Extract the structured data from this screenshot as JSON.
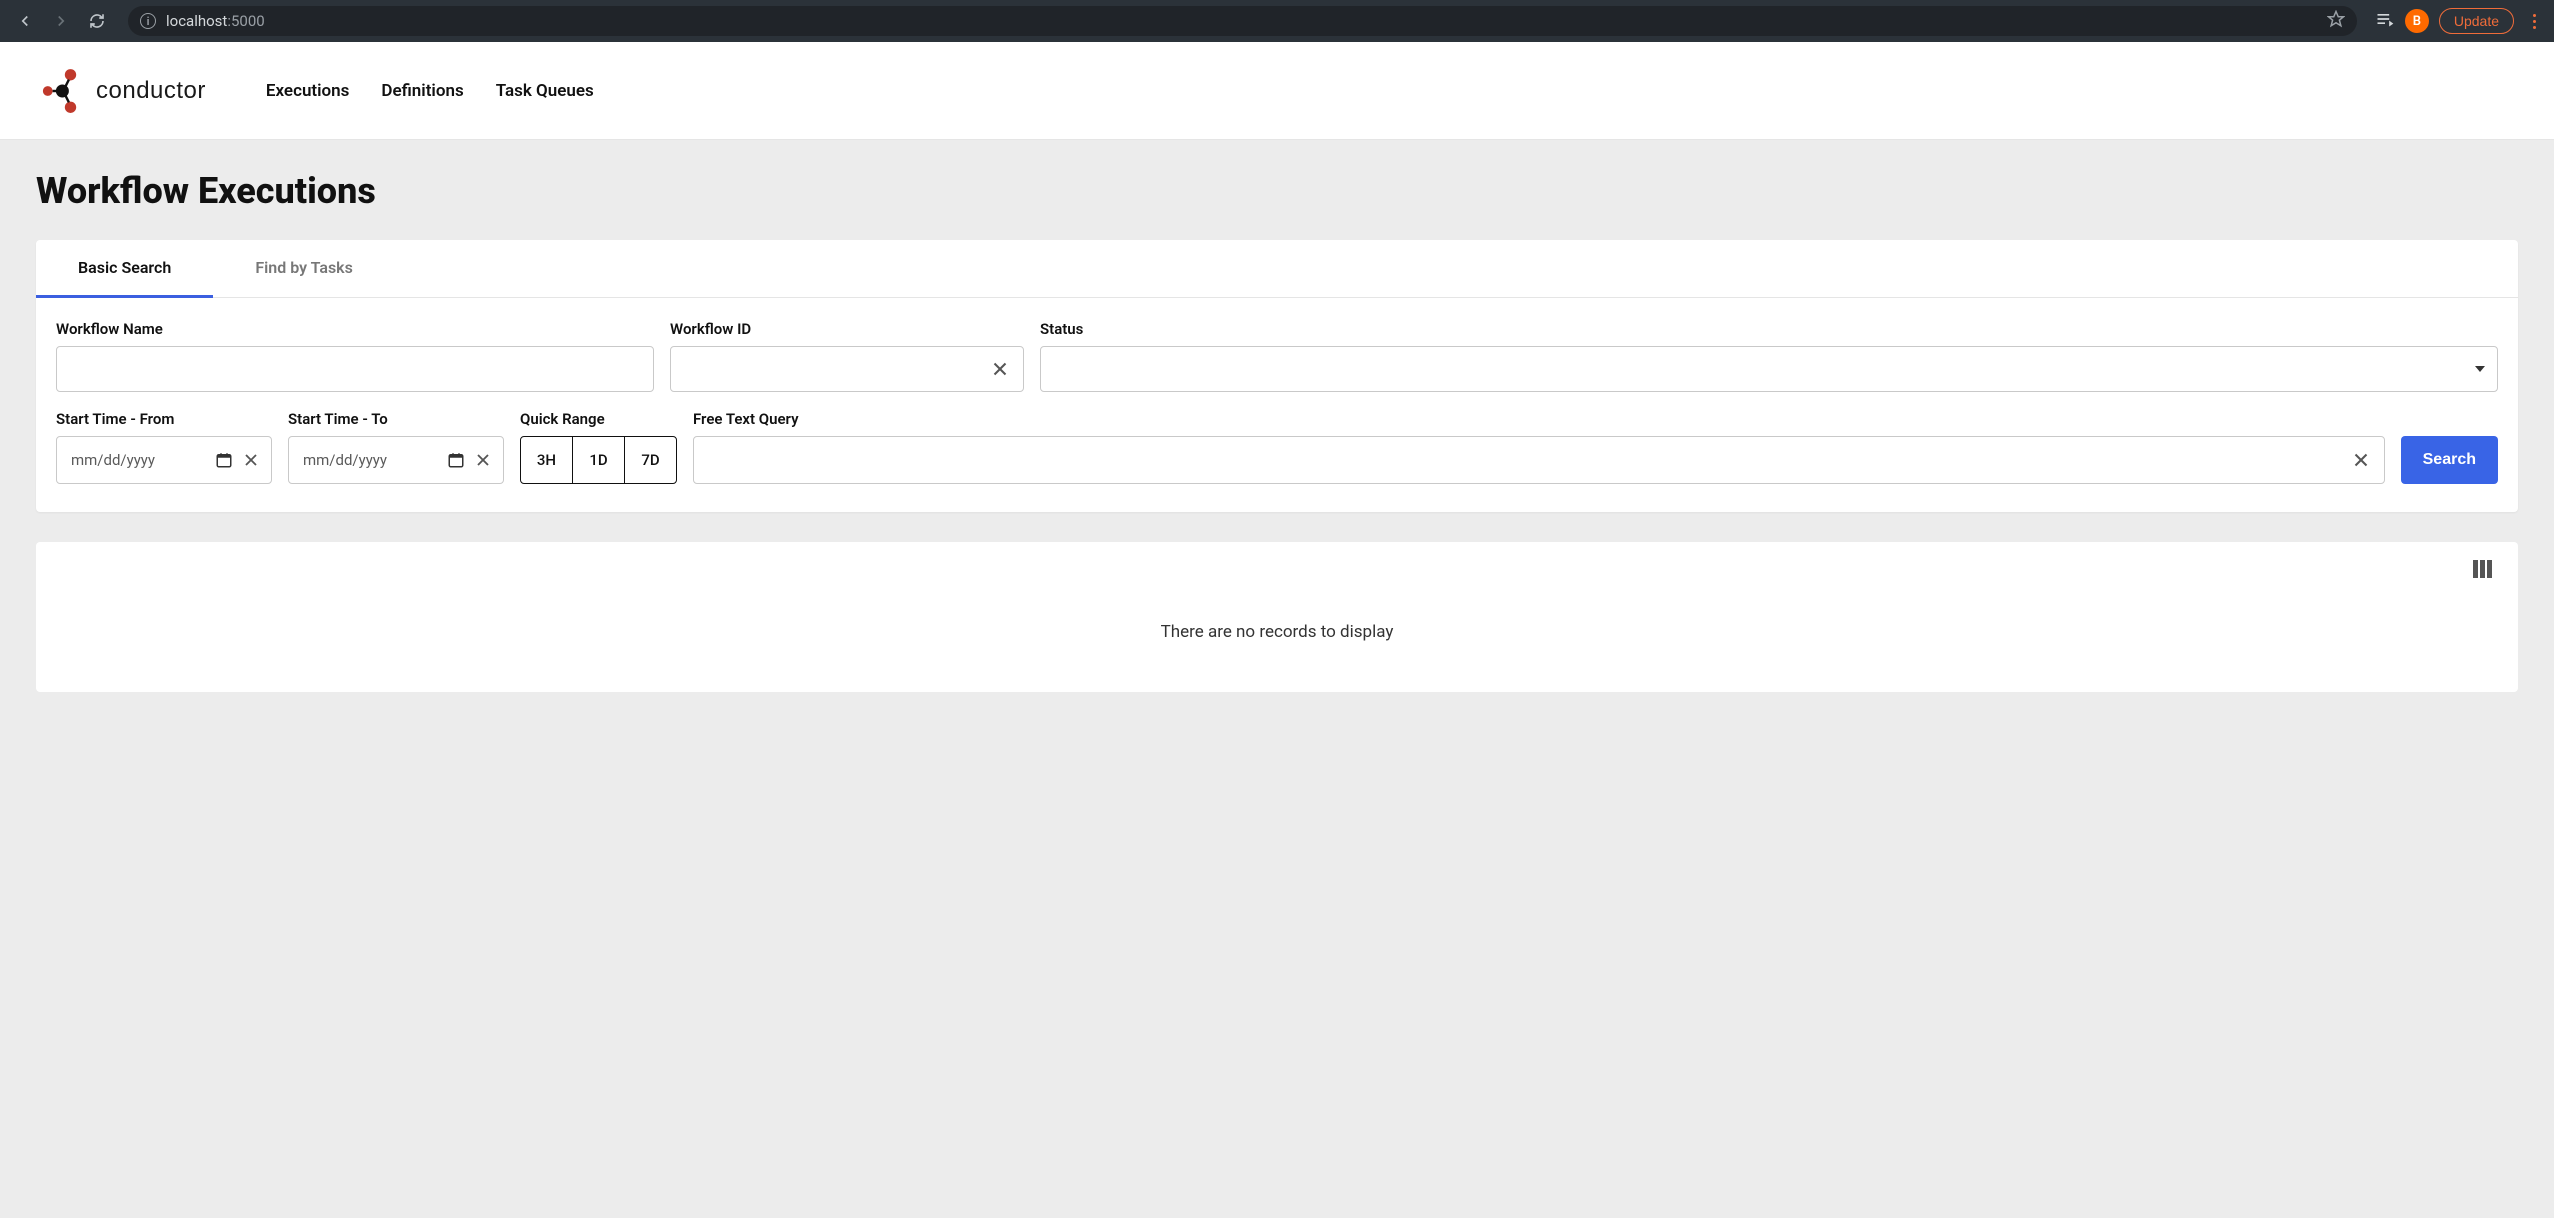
{
  "browser": {
    "url_host": "localhost",
    "url_port": ":5000",
    "avatar_initial": "B",
    "update_label": "Update"
  },
  "header": {
    "brand": "conductor",
    "nav": {
      "executions": "Executions",
      "definitions": "Definitions",
      "task_queues": "Task Queues"
    }
  },
  "page": {
    "title": "Workflow Executions"
  },
  "tabs": {
    "basic": "Basic Search",
    "by_tasks": "Find by Tasks"
  },
  "form": {
    "workflow_name_label": "Workflow Name",
    "workflow_id_label": "Workflow ID",
    "status_label": "Status",
    "start_from_label": "Start Time - From",
    "start_to_label": "Start Time - To",
    "quick_range_label": "Quick Range",
    "free_text_label": "Free Text Query",
    "date_placeholder_from": "mm/dd/yyyy",
    "date_placeholder_to": "mm/dd/yyyy",
    "quick_range": {
      "h3": "3H",
      "d1": "1D",
      "d7": "7D"
    },
    "search_btn": "Search"
  },
  "results": {
    "empty": "There are no records to display"
  }
}
